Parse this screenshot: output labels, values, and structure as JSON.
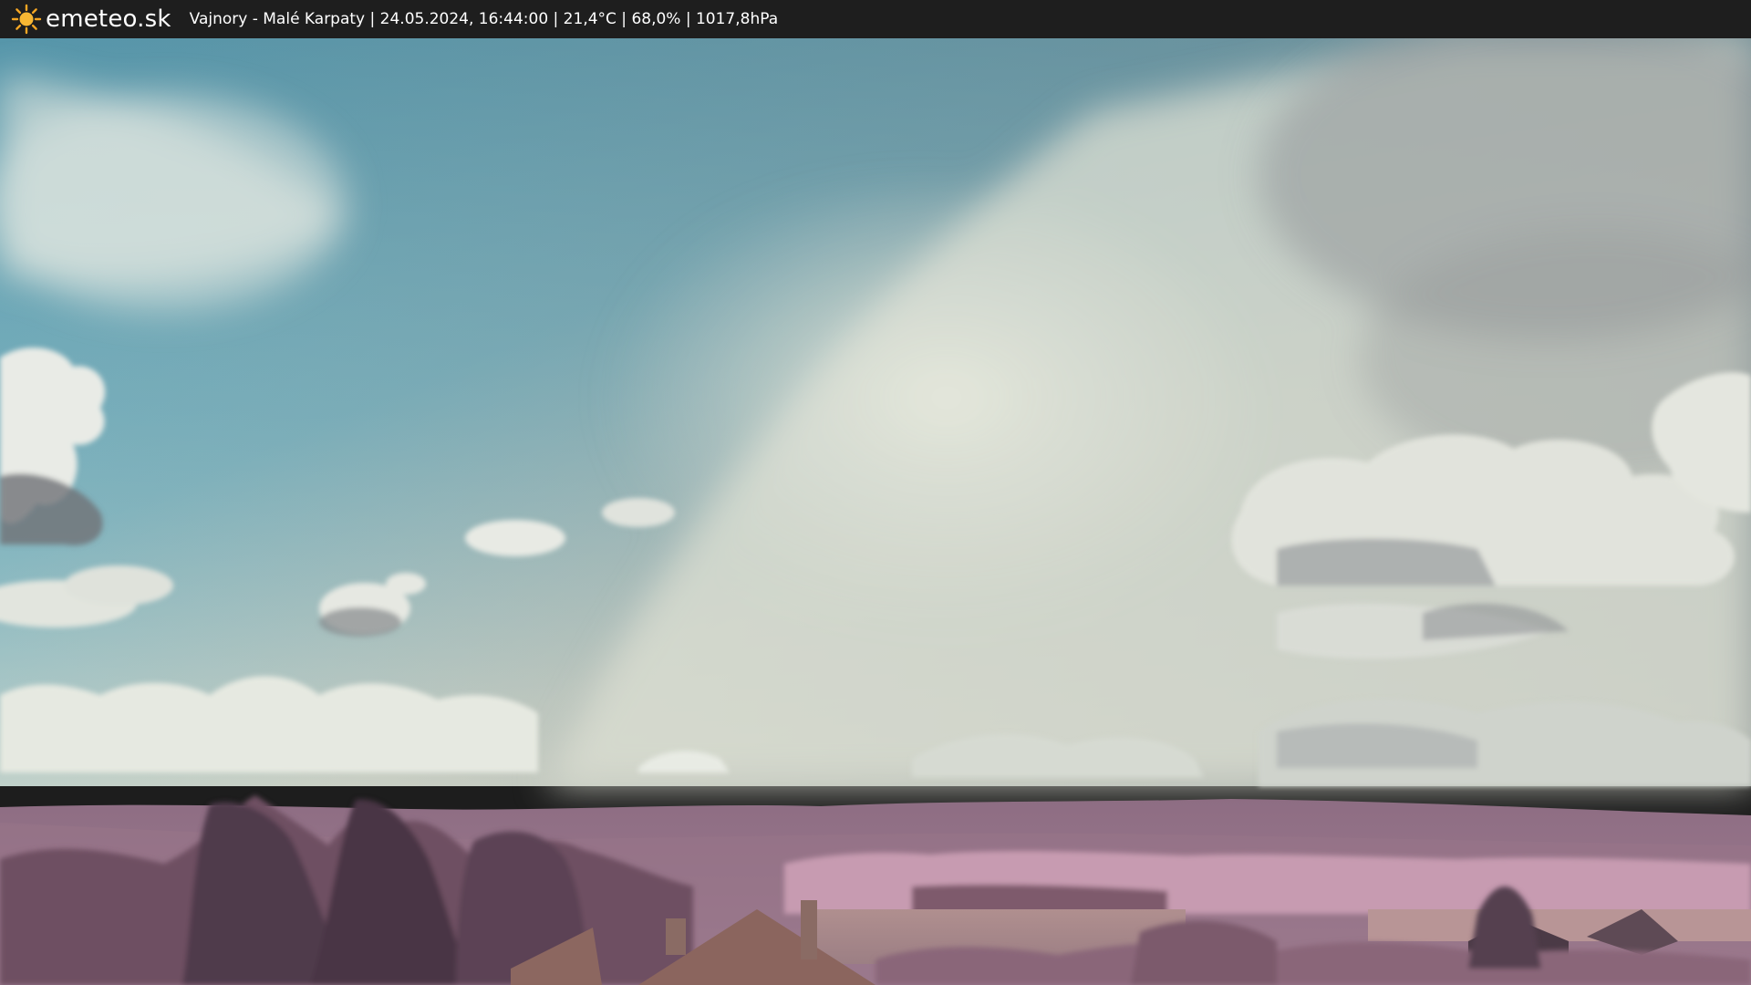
{
  "header": {
    "logo_icon": "sun-icon",
    "site_name": "emeteo.sk",
    "info": "Vajnory - Malé Karpaty | 24.05.2024, 16:44:00 | 21,4°C | 68,0% | 1017,8hPa"
  },
  "colors": {
    "header_bg": "#1e1e1e",
    "sun": "#f5a623",
    "sky_blue": "#5b98a9",
    "cloud": "#d9dccf",
    "foliage": "#a17a90"
  }
}
